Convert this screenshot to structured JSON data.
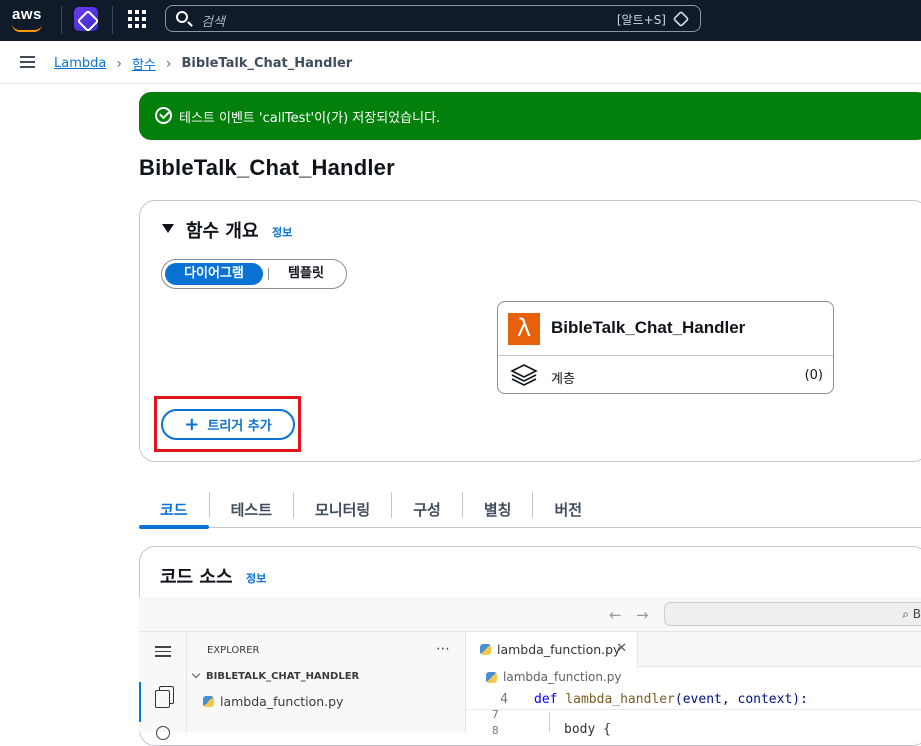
{
  "topnav": {
    "logo": "aws",
    "search_placeholder": "검색",
    "search_shortcut": "[알트+S]"
  },
  "breadcrumb": {
    "items": [
      "Lambda",
      "함수"
    ],
    "current": "BibleTalk_Chat_Handler"
  },
  "flash": {
    "message": "테스트 이벤트 'callTest'이(가) 저장되었습니다."
  },
  "page_title": "BibleTalk_Chat_Handler",
  "overview": {
    "title": "함수 개요",
    "info": "정보",
    "segments": [
      "다이어그램",
      "템플릿"
    ],
    "selected_segment": "다이어그램",
    "function_name": "BibleTalk_Chat_Handler",
    "layers_label": "계층",
    "layers_count": "(0)",
    "add_trigger_label": "트리거 추가"
  },
  "tabs": [
    "코드",
    "테스트",
    "모니터링",
    "구성",
    "별칭",
    "버전"
  ],
  "active_tab": "코드",
  "code_source": {
    "title": "코드 소스",
    "info": "정보"
  },
  "ide": {
    "search_hint": "B",
    "explorer_title": "EXPLORER",
    "folder": "BIBLETALK_CHAT_HANDLER",
    "file": "lambda_function.py",
    "tab_file": "lambda_function.py",
    "editor_breadcrumb": "lambda_function.py",
    "line_number": "4",
    "code_kw": "def",
    "code_fn": "lambda_handler",
    "code_params": "(event, context):",
    "line_partial_1": "7",
    "line_partial_2": "8",
    "code_fragment": "body   {"
  },
  "colors": {
    "nav_bg": "#0f1b2a",
    "accent": "#0972d3",
    "success": "#037f0c",
    "lambda_orange": "#e7600a",
    "highlight_red": "#e3131d"
  }
}
